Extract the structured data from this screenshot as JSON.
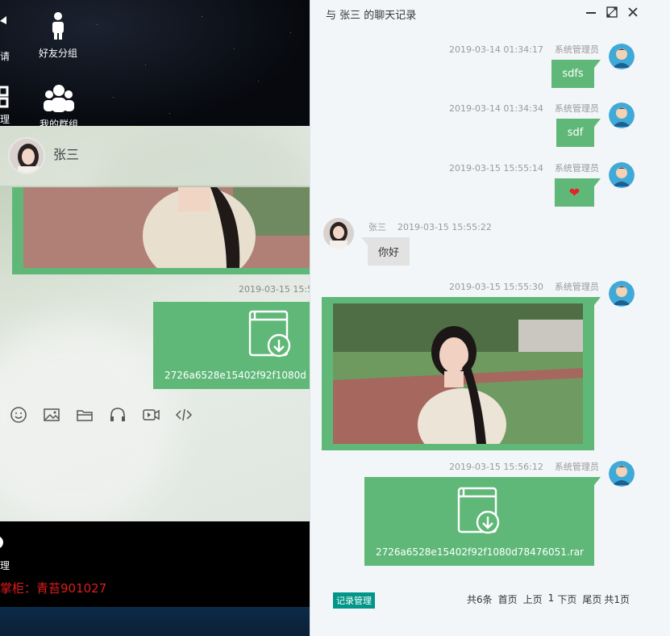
{
  "background_app": {
    "desktop_icons": [
      {
        "label": "请",
        "icon": "invite-icon"
      },
      {
        "label": "好友分组",
        "icon": "user-icon"
      },
      {
        "label": "理",
        "icon": "grid-icon"
      },
      {
        "label": "我的群组",
        "icon": "group-icon"
      }
    ],
    "chat": {
      "contact_name": "张三",
      "timestamp": "2019-03-15 15:5",
      "file_name": "2726a6528e15402f92f1080d",
      "toolbar": [
        "emoji-icon",
        "image-icon",
        "folder-icon",
        "audio-icon",
        "video-icon",
        "code-icon"
      ]
    },
    "bottom_manage_label": "理",
    "shopkeeper": "掌柜：青苔901027"
  },
  "history": {
    "title": "与 张三 的聊天记录",
    "controls": [
      "minimize-icon",
      "maximize-icon",
      "close-icon"
    ],
    "messages": [
      {
        "time": "2019-03-14 01:34:17",
        "sender": "系统管理员",
        "text": "sdfs",
        "mine": true
      },
      {
        "time": "2019-03-14 01:34:34",
        "sender": "系统管理员",
        "text": "sdf",
        "mine": true
      },
      {
        "time": "2019-03-15 15:55:14",
        "sender": "系统管理员",
        "text": "❤",
        "mine": true
      },
      {
        "time": "2019-03-15 15:55:22",
        "sender": "张三",
        "text": "你好",
        "mine": false
      },
      {
        "time": "2019-03-15 15:55:30",
        "sender": "系统管理员",
        "type": "image",
        "mine": true
      },
      {
        "time": "2019-03-15 15:56:12",
        "sender": "系统管理员",
        "type": "file",
        "file_name": "2726a6528e15402f92f1080d78476051.rar",
        "mine": true
      }
    ],
    "footer": {
      "records_button": "记录管理",
      "total": "共6条",
      "first": "首页",
      "prev": "上页",
      "current": "1",
      "next": "下页",
      "last": "尾页",
      "pages": "共1页"
    }
  },
  "colors": {
    "accent_green": "#5fb878",
    "records_button": "#009688",
    "shopkeeper_red": "#e11b1b"
  }
}
